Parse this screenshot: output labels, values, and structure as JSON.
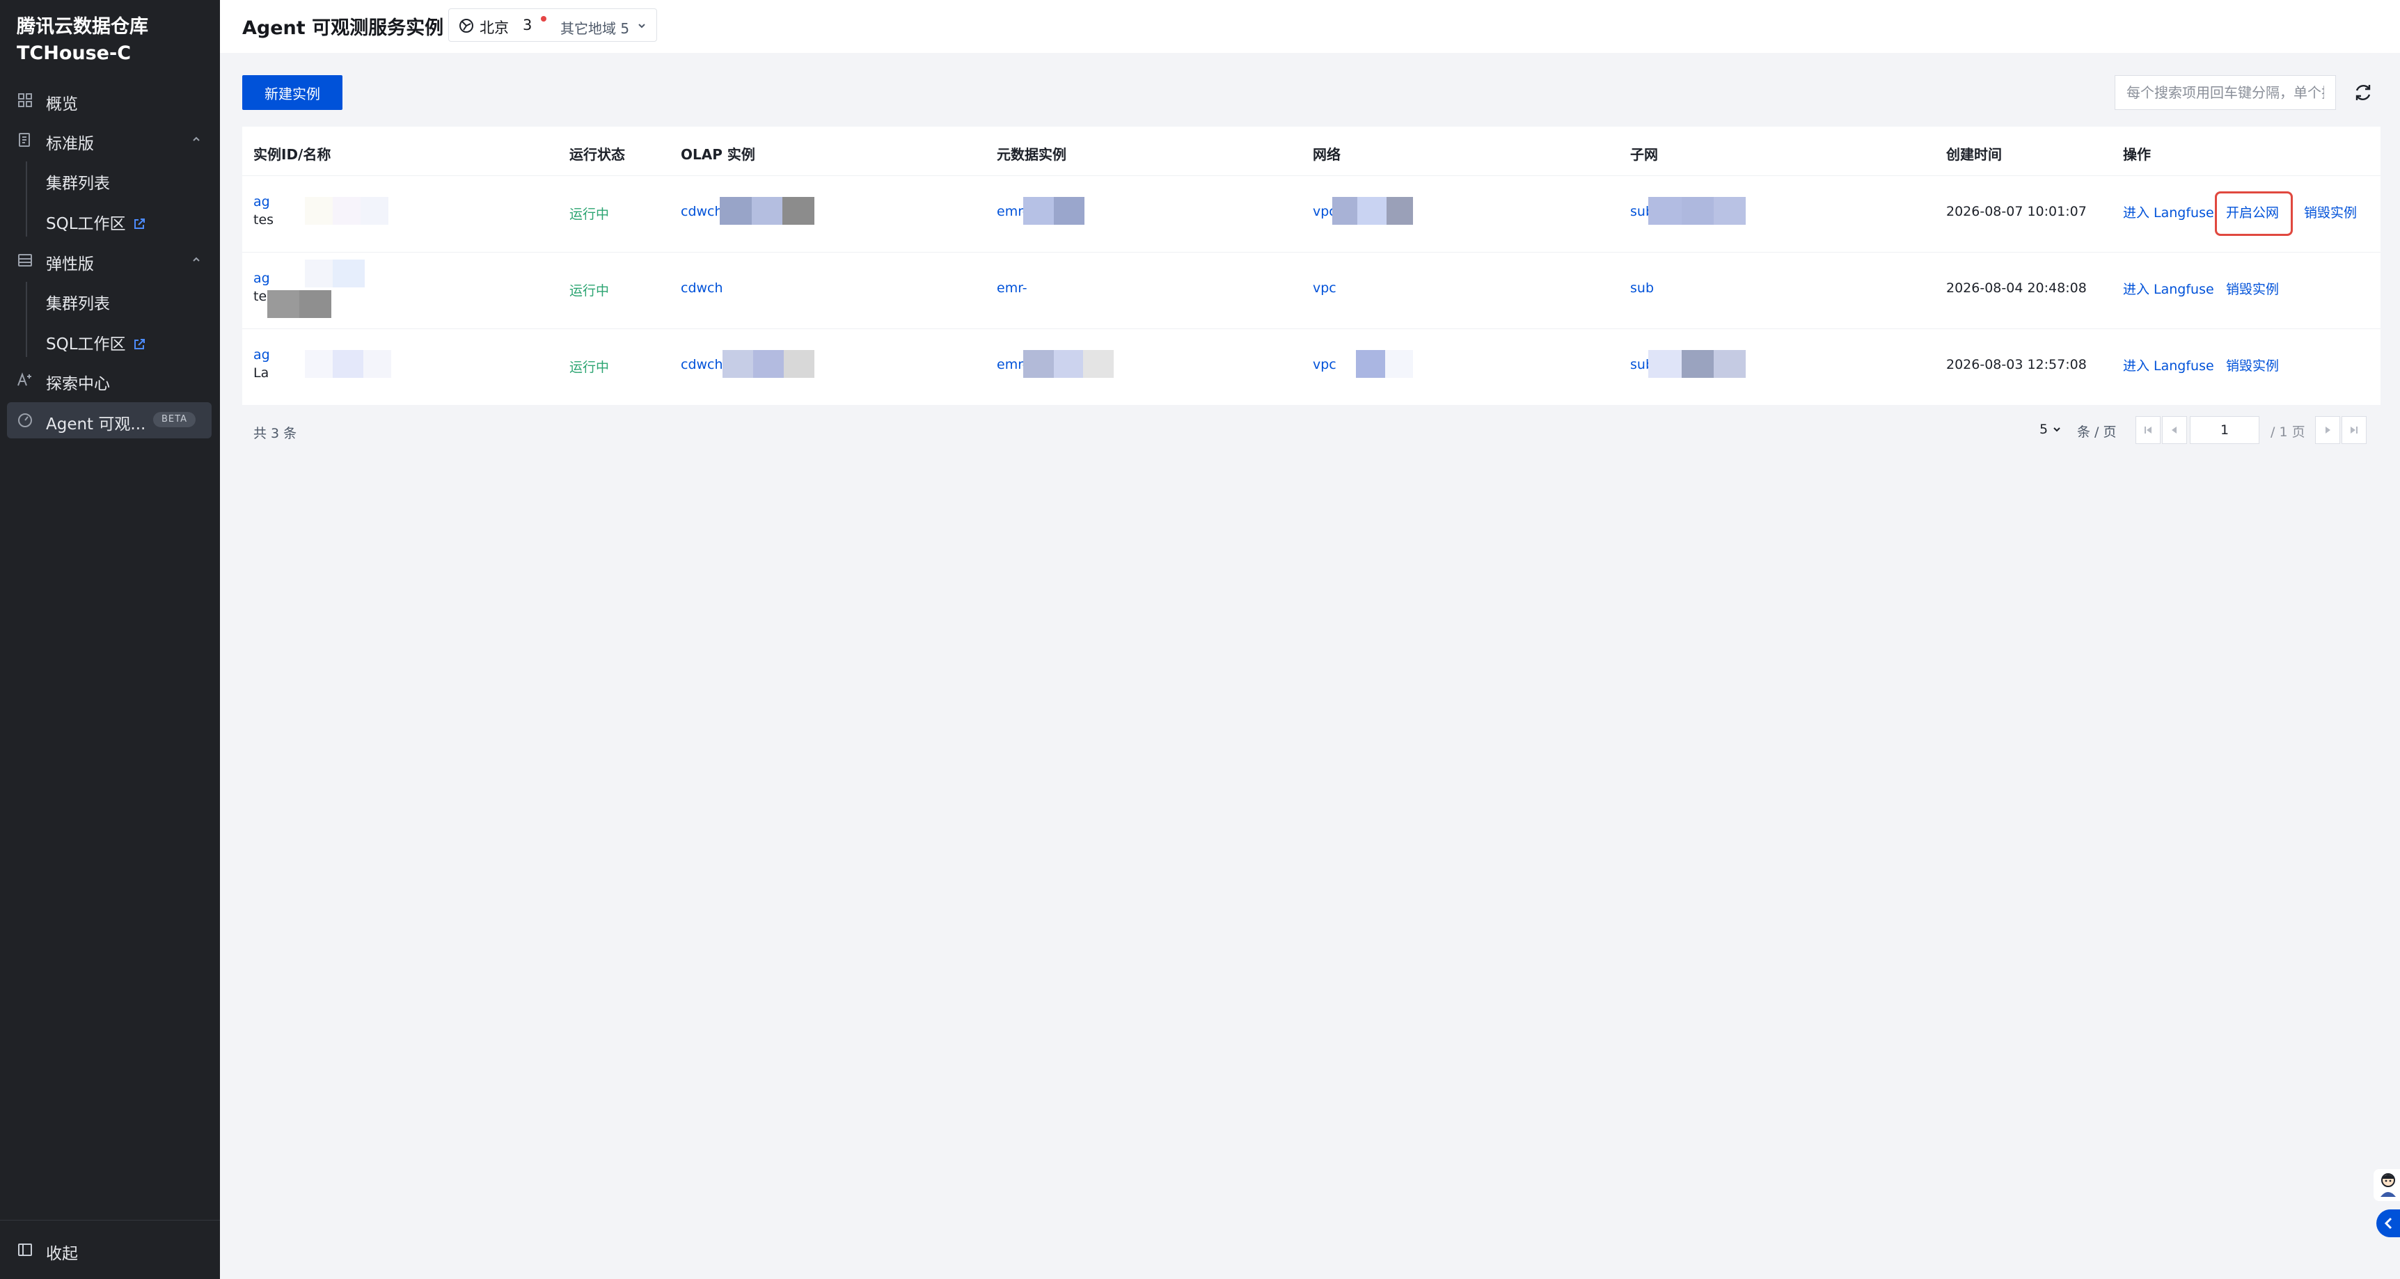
{
  "brand": {
    "line1": "腾讯云数据仓库",
    "line2": "TCHouse-C"
  },
  "sidebar": {
    "items": [
      {
        "label": "概览",
        "icon": "grid-icon"
      },
      {
        "label": "标准版",
        "icon": "document-icon",
        "expanded": true
      },
      {
        "label": "集群列表"
      },
      {
        "label": "SQL工作区",
        "external": true
      },
      {
        "label": "弹性版",
        "icon": "layers-icon",
        "expanded": true
      },
      {
        "label": "集群列表"
      },
      {
        "label": "SQL工作区",
        "external": true
      },
      {
        "label": "探索中心",
        "icon": "ai-icon"
      },
      {
        "label": "Agent 可观...",
        "icon": "gauge-icon",
        "badge": "BETA",
        "active": true
      }
    ],
    "collapse_label": "收起"
  },
  "header": {
    "title": "Agent 可观测服务实例",
    "region": {
      "name": "北京",
      "count": "3",
      "other": "其它地域 5"
    }
  },
  "toolbar": {
    "new_button": "新建实例",
    "search_placeholder": "每个搜索项用回车键分隔，单个搜"
  },
  "table": {
    "columns": [
      "实例ID/名称",
      "运行状态",
      "OLAP 实例",
      "元数据实例",
      "网络",
      "子网",
      "创建时间",
      "操作"
    ],
    "rows": [
      {
        "id": "ag",
        "name": "tes",
        "status": "运行中",
        "olap": "cdwch",
        "meta": "emr-",
        "vpc": "vpc",
        "subnet": "sub",
        "created": "2026-08-07 10:01:07",
        "ops": [
          "进入 Langfuse",
          "开启公网",
          "销毁实例"
        ],
        "highlighted_op": 1
      },
      {
        "id": "ag",
        "name": "tes",
        "status": "运行中",
        "olap": "cdwch",
        "meta": "emr-",
        "vpc": "vpc",
        "subnet": "sub",
        "created": "2026-08-04 20:48:08",
        "ops": [
          "进入 Langfuse",
          "销毁实例"
        ]
      },
      {
        "id": "ag",
        "name": "La",
        "status": "运行中",
        "olap": "cdwch",
        "meta": "emr-",
        "vpc": "vpc",
        "subnet": "sub",
        "created": "2026-08-03 12:57:08",
        "ops": [
          "进入 Langfuse",
          "销毁实例"
        ]
      }
    ]
  },
  "pagination": {
    "total": "共 3 条",
    "page_size": "5",
    "page_unit": "条 / 页",
    "current_page": "1",
    "of_pages": "/ 1 页"
  },
  "colors": {
    "sidebar_bg": "#202226",
    "primary": "#0052d9",
    "success": "#2ba471",
    "highlight": "#e0483f"
  }
}
